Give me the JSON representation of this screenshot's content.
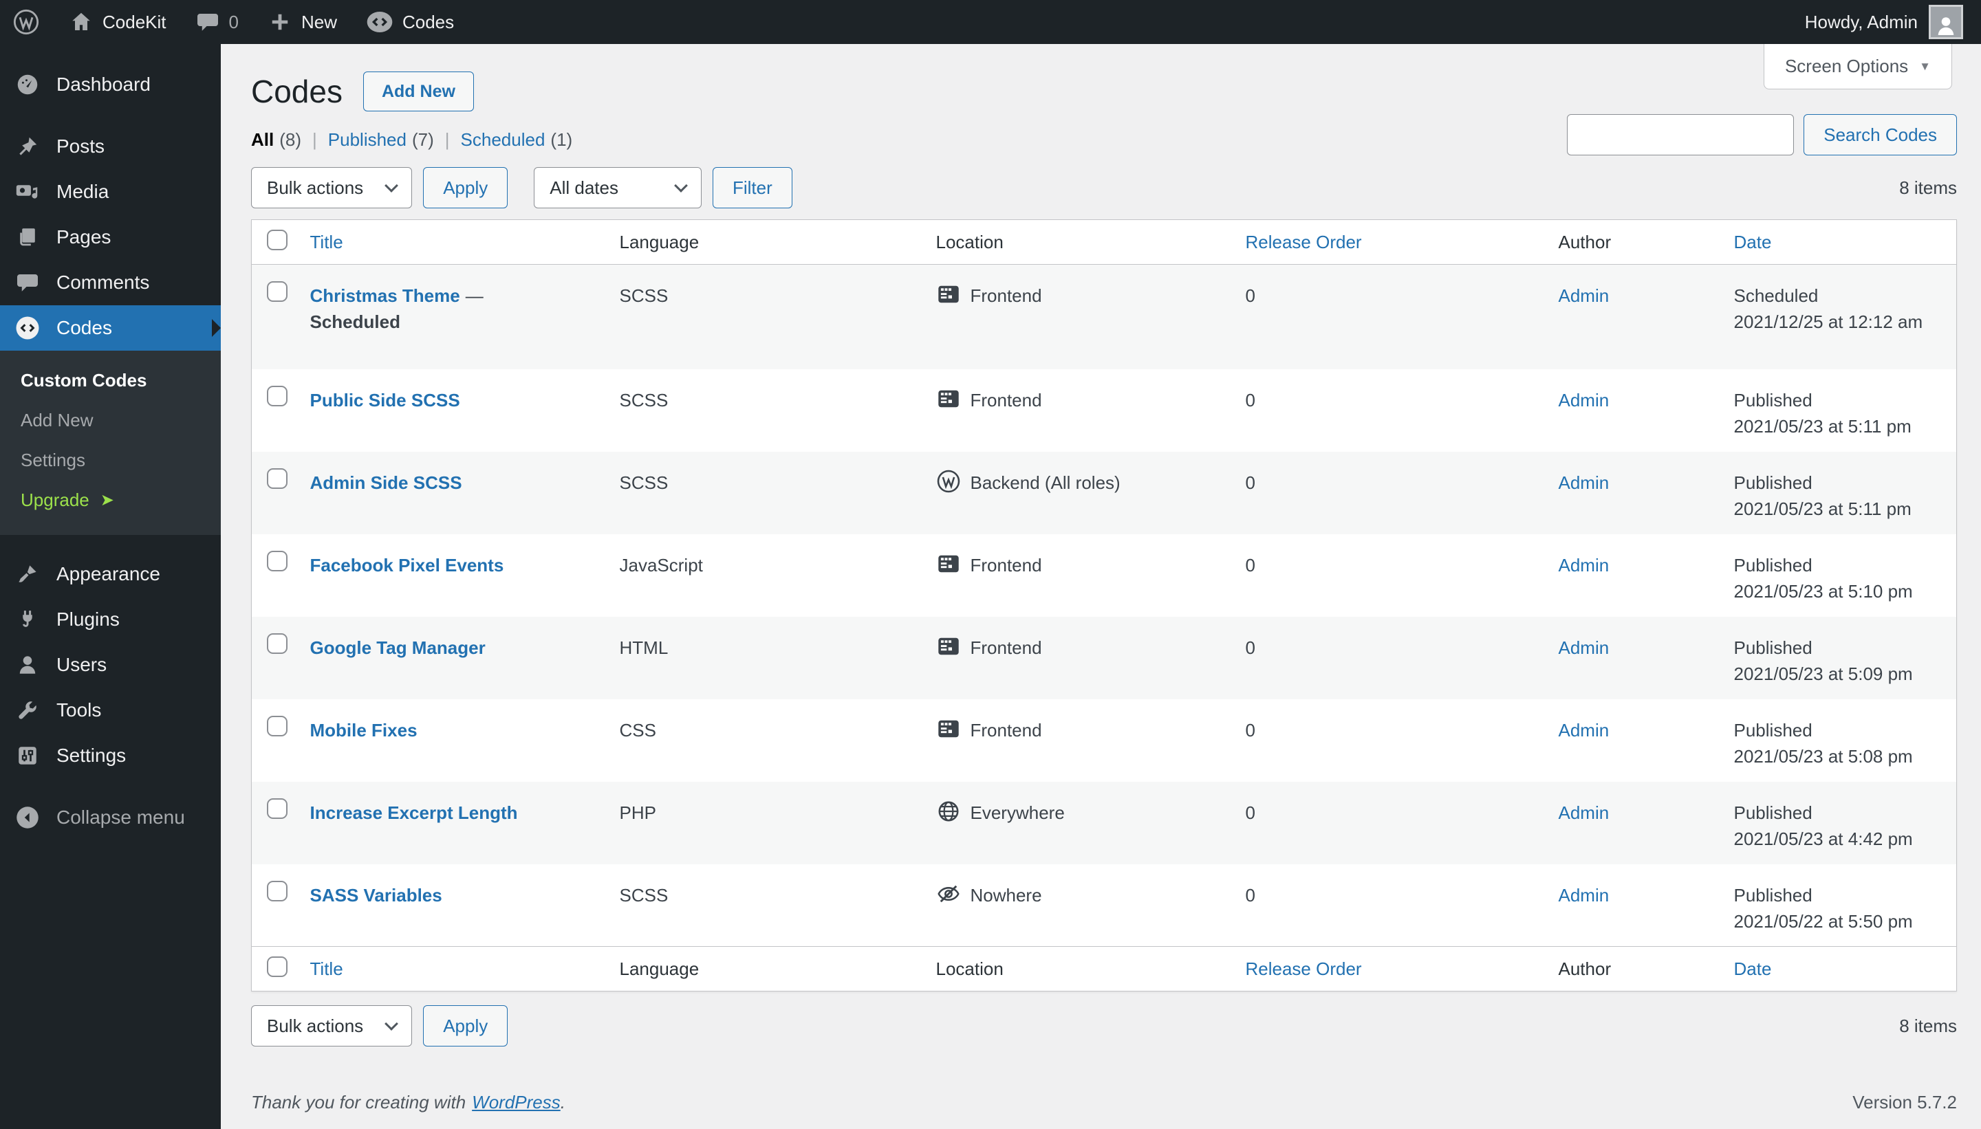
{
  "admin_bar": {
    "site_name": "CodeKit",
    "comments_count": "0",
    "new_label": "New",
    "codes_label": "Codes",
    "howdy": "Howdy, Admin"
  },
  "sidebar": {
    "items": [
      {
        "label": "Dashboard"
      },
      {
        "label": "Posts"
      },
      {
        "label": "Media"
      },
      {
        "label": "Pages"
      },
      {
        "label": "Comments"
      },
      {
        "label": "Codes"
      },
      {
        "label": "Appearance"
      },
      {
        "label": "Plugins"
      },
      {
        "label": "Users"
      },
      {
        "label": "Tools"
      },
      {
        "label": "Settings"
      },
      {
        "label": "Collapse menu"
      }
    ],
    "submenu": {
      "title": "Custom Codes",
      "items": [
        {
          "label": "Add New"
        },
        {
          "label": "Settings"
        },
        {
          "label": "Upgrade"
        }
      ]
    }
  },
  "icons": {
    "screen_options_caret": "▼",
    "upgrade_arrow": "➤"
  },
  "page": {
    "title": "Codes",
    "add_new_button": "Add New",
    "screen_options_label": "Screen Options",
    "filters": {
      "separator": "|",
      "items": [
        {
          "label": "All",
          "count": "(8)"
        },
        {
          "label": "Published",
          "count": "(7)"
        },
        {
          "label": "Scheduled",
          "count": "(1)"
        }
      ]
    }
  },
  "toolbar": {
    "bulk_actions": "Bulk actions",
    "apply": "Apply",
    "all_dates": "All dates",
    "filter": "Filter",
    "items_count": "8 items"
  },
  "search": {
    "value": "",
    "button_label": "Search Codes"
  },
  "table": {
    "columns": {
      "title": "Title",
      "language": "Language",
      "location": "Location",
      "release_order": "Release Order",
      "author": "Author",
      "date": "Date"
    },
    "rows": [
      {
        "title": "Christmas Theme",
        "state_separator": "—",
        "state": "Scheduled",
        "language": "SCSS",
        "location": "Frontend",
        "location_icon": "frontend-layout-icon",
        "release_order": "0",
        "author": "Admin",
        "status": "Scheduled",
        "date": "2021/12/25 at 12:12 am"
      },
      {
        "title": "Public Side SCSS",
        "language": "SCSS",
        "location": "Frontend",
        "location_icon": "frontend-layout-icon",
        "release_order": "0",
        "author": "Admin",
        "status": "Published",
        "date": "2021/05/23 at 5:11 pm"
      },
      {
        "title": "Admin Side SCSS",
        "language": "SCSS",
        "location": "Backend (All roles)",
        "location_icon": "wordpress-icon",
        "release_order": "0",
        "author": "Admin",
        "status": "Published",
        "date": "2021/05/23 at 5:11 pm"
      },
      {
        "title": "Facebook Pixel Events",
        "language": "JavaScript",
        "location": "Frontend",
        "location_icon": "frontend-layout-icon",
        "release_order": "0",
        "author": "Admin",
        "status": "Published",
        "date": "2021/05/23 at 5:10 pm"
      },
      {
        "title": "Google Tag Manager",
        "language": "HTML",
        "location": "Frontend",
        "location_icon": "frontend-layout-icon",
        "release_order": "0",
        "author": "Admin",
        "status": "Published",
        "date": "2021/05/23 at 5:09 pm"
      },
      {
        "title": "Mobile Fixes",
        "language": "CSS",
        "location": "Frontend",
        "location_icon": "frontend-layout-icon",
        "release_order": "0",
        "author": "Admin",
        "status": "Published",
        "date": "2021/05/23 at 5:08 pm"
      },
      {
        "title": "Increase Excerpt Length",
        "language": "PHP",
        "location": "Everywhere",
        "location_icon": "globe-icon",
        "release_order": "0",
        "author": "Admin",
        "status": "Published",
        "date": "2021/05/23 at 4:42 pm"
      },
      {
        "title": "SASS Variables",
        "language": "SCSS",
        "location": "Nowhere",
        "location_icon": "hidden-eye-icon",
        "release_order": "0",
        "author": "Admin",
        "status": "Published",
        "date": "2021/05/22 at 5:50 pm"
      }
    ]
  },
  "footer": {
    "thanks_prefix": "Thank you for creating with",
    "wordpress_link": "WordPress",
    "thanks_suffix": ".",
    "version": "Version 5.7.2",
    "items_count": "8 items"
  },
  "colors": {
    "accent_blue": "#2271b1",
    "sidebar_bg": "#1d2327",
    "submenu_bg": "#2c3338",
    "content_bg": "#f0f0f1",
    "table_border": "#c3c4c7",
    "striped_row": "#f6f7f7",
    "upgrade_green": "#9ce14b",
    "text_dark": "#3c434a"
  }
}
